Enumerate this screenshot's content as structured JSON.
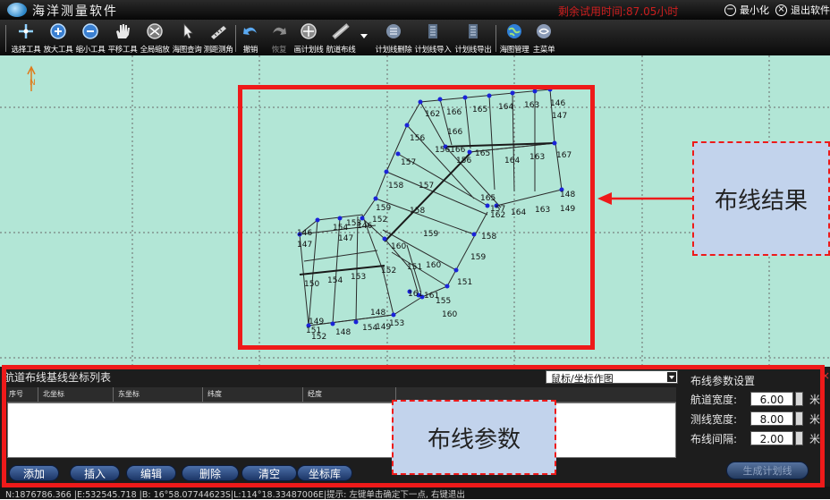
{
  "window": {
    "title": "海洋测量软件",
    "trial_text": "剩余试用时间:87.05小时",
    "minimize_label": "最小化",
    "exit_label": "退出软件"
  },
  "toolbar": {
    "tools": [
      {
        "label": "选择工具",
        "icon": "cross-arrow-icon"
      },
      {
        "label": "放大工具",
        "icon": "zoom-in-icon"
      },
      {
        "label": "缩小工具",
        "icon": "zoom-out-icon"
      },
      {
        "label": "平移工具",
        "icon": "hand-icon"
      },
      {
        "label": "全局缩放",
        "icon": "globe-zoom-icon"
      },
      {
        "label": "海图查询",
        "icon": "query-pointer-icon"
      },
      {
        "label": "测距测角",
        "icon": "ruler-icon"
      },
      {
        "label": "撤销",
        "icon": "undo-icon"
      },
      {
        "label": "恢复",
        "icon": "redo-icon"
      },
      {
        "label": "画计划线",
        "icon": "draw-line-icon"
      },
      {
        "label": "航道布线",
        "icon": "route-icon"
      },
      {
        "label": "计划线删除",
        "icon": "delete-line-icon"
      },
      {
        "label": "计划线导入",
        "icon": "import-icon"
      },
      {
        "label": "计划线导出",
        "icon": "export-icon"
      },
      {
        "label": "海图管理",
        "icon": "chart-manage-icon"
      },
      {
        "label": "主菜单",
        "icon": "main-menu-icon"
      }
    ]
  },
  "map": {
    "north_label": "N",
    "labels": [
      "146",
      "163",
      "164",
      "165",
      "166",
      "162",
      "147",
      "166",
      "156",
      "156166",
      "165",
      "164",
      "163",
      "167",
      "156",
      "157",
      "157",
      "165",
      "148",
      "158",
      "158",
      "157",
      "162",
      "164",
      "163",
      "149",
      "159",
      "152",
      "153",
      "154",
      "146",
      "146",
      "147",
      "147",
      "159",
      "158",
      "160",
      "151",
      "160",
      "159",
      "153",
      "154",
      "150",
      "152",
      "151",
      "161",
      "161",
      "155",
      "160",
      "148",
      "149",
      "152",
      "153",
      "154",
      "148",
      "149",
      "151"
    ]
  },
  "list_panel": {
    "title": "航道布线基线坐标列表",
    "mode_selected": "鼠标/坐标作图",
    "columns": [
      "序号",
      "北坐标",
      "东坐标",
      "纬度",
      "经度"
    ],
    "buttons": [
      "添加",
      "插入",
      "编辑",
      "删除",
      "清空",
      "坐标库"
    ]
  },
  "param_panel": {
    "title": "布线参数设置",
    "fields": [
      {
        "label": "航道宽度:",
        "value": "6.00",
        "unit": "米"
      },
      {
        "label": "测线宽度:",
        "value": "8.00",
        "unit": "米"
      },
      {
        "label": "布线间隔:",
        "value": "2.00",
        "unit": "米"
      }
    ],
    "generate_label": "生成计划线"
  },
  "status": {
    "text": "N:1876786.366  |E:532545.718    |B: 16°58.07744623S|L:114°18.33487006E|提示: 左键单击确定下一点, 右键退出"
  },
  "annotations": {
    "result_label": "布线结果",
    "param_label": "布线参数",
    "highlight_color": "#ee1a1a",
    "callout_fill": "#c2d3ec"
  }
}
